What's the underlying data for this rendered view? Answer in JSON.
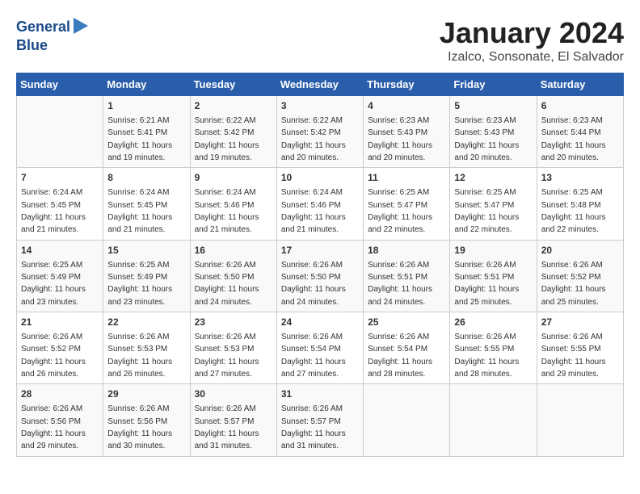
{
  "logo": {
    "line1": "General",
    "line2": "Blue"
  },
  "title": "January 2024",
  "subtitle": "Izalco, Sonsonate, El Salvador",
  "headers": [
    "Sunday",
    "Monday",
    "Tuesday",
    "Wednesday",
    "Thursday",
    "Friday",
    "Saturday"
  ],
  "weeks": [
    [
      {
        "day": "",
        "detail": ""
      },
      {
        "day": "1",
        "detail": "Sunrise: 6:21 AM\nSunset: 5:41 PM\nDaylight: 11 hours\nand 19 minutes."
      },
      {
        "day": "2",
        "detail": "Sunrise: 6:22 AM\nSunset: 5:42 PM\nDaylight: 11 hours\nand 19 minutes."
      },
      {
        "day": "3",
        "detail": "Sunrise: 6:22 AM\nSunset: 5:42 PM\nDaylight: 11 hours\nand 20 minutes."
      },
      {
        "day": "4",
        "detail": "Sunrise: 6:23 AM\nSunset: 5:43 PM\nDaylight: 11 hours\nand 20 minutes."
      },
      {
        "day": "5",
        "detail": "Sunrise: 6:23 AM\nSunset: 5:43 PM\nDaylight: 11 hours\nand 20 minutes."
      },
      {
        "day": "6",
        "detail": "Sunrise: 6:23 AM\nSunset: 5:44 PM\nDaylight: 11 hours\nand 20 minutes."
      }
    ],
    [
      {
        "day": "7",
        "detail": "Sunrise: 6:24 AM\nSunset: 5:45 PM\nDaylight: 11 hours\nand 21 minutes."
      },
      {
        "day": "8",
        "detail": "Sunrise: 6:24 AM\nSunset: 5:45 PM\nDaylight: 11 hours\nand 21 minutes."
      },
      {
        "day": "9",
        "detail": "Sunrise: 6:24 AM\nSunset: 5:46 PM\nDaylight: 11 hours\nand 21 minutes."
      },
      {
        "day": "10",
        "detail": "Sunrise: 6:24 AM\nSunset: 5:46 PM\nDaylight: 11 hours\nand 21 minutes."
      },
      {
        "day": "11",
        "detail": "Sunrise: 6:25 AM\nSunset: 5:47 PM\nDaylight: 11 hours\nand 22 minutes."
      },
      {
        "day": "12",
        "detail": "Sunrise: 6:25 AM\nSunset: 5:47 PM\nDaylight: 11 hours\nand 22 minutes."
      },
      {
        "day": "13",
        "detail": "Sunrise: 6:25 AM\nSunset: 5:48 PM\nDaylight: 11 hours\nand 22 minutes."
      }
    ],
    [
      {
        "day": "14",
        "detail": "Sunrise: 6:25 AM\nSunset: 5:49 PM\nDaylight: 11 hours\nand 23 minutes."
      },
      {
        "day": "15",
        "detail": "Sunrise: 6:25 AM\nSunset: 5:49 PM\nDaylight: 11 hours\nand 23 minutes."
      },
      {
        "day": "16",
        "detail": "Sunrise: 6:26 AM\nSunset: 5:50 PM\nDaylight: 11 hours\nand 24 minutes."
      },
      {
        "day": "17",
        "detail": "Sunrise: 6:26 AM\nSunset: 5:50 PM\nDaylight: 11 hours\nand 24 minutes."
      },
      {
        "day": "18",
        "detail": "Sunrise: 6:26 AM\nSunset: 5:51 PM\nDaylight: 11 hours\nand 24 minutes."
      },
      {
        "day": "19",
        "detail": "Sunrise: 6:26 AM\nSunset: 5:51 PM\nDaylight: 11 hours\nand 25 minutes."
      },
      {
        "day": "20",
        "detail": "Sunrise: 6:26 AM\nSunset: 5:52 PM\nDaylight: 11 hours\nand 25 minutes."
      }
    ],
    [
      {
        "day": "21",
        "detail": "Sunrise: 6:26 AM\nSunset: 5:52 PM\nDaylight: 11 hours\nand 26 minutes."
      },
      {
        "day": "22",
        "detail": "Sunrise: 6:26 AM\nSunset: 5:53 PM\nDaylight: 11 hours\nand 26 minutes."
      },
      {
        "day": "23",
        "detail": "Sunrise: 6:26 AM\nSunset: 5:53 PM\nDaylight: 11 hours\nand 27 minutes."
      },
      {
        "day": "24",
        "detail": "Sunrise: 6:26 AM\nSunset: 5:54 PM\nDaylight: 11 hours\nand 27 minutes."
      },
      {
        "day": "25",
        "detail": "Sunrise: 6:26 AM\nSunset: 5:54 PM\nDaylight: 11 hours\nand 28 minutes."
      },
      {
        "day": "26",
        "detail": "Sunrise: 6:26 AM\nSunset: 5:55 PM\nDaylight: 11 hours\nand 28 minutes."
      },
      {
        "day": "27",
        "detail": "Sunrise: 6:26 AM\nSunset: 5:55 PM\nDaylight: 11 hours\nand 29 minutes."
      }
    ],
    [
      {
        "day": "28",
        "detail": "Sunrise: 6:26 AM\nSunset: 5:56 PM\nDaylight: 11 hours\nand 29 minutes."
      },
      {
        "day": "29",
        "detail": "Sunrise: 6:26 AM\nSunset: 5:56 PM\nDaylight: 11 hours\nand 30 minutes."
      },
      {
        "day": "30",
        "detail": "Sunrise: 6:26 AM\nSunset: 5:57 PM\nDaylight: 11 hours\nand 31 minutes."
      },
      {
        "day": "31",
        "detail": "Sunrise: 6:26 AM\nSunset: 5:57 PM\nDaylight: 11 hours\nand 31 minutes."
      },
      {
        "day": "",
        "detail": ""
      },
      {
        "day": "",
        "detail": ""
      },
      {
        "day": "",
        "detail": ""
      }
    ]
  ]
}
